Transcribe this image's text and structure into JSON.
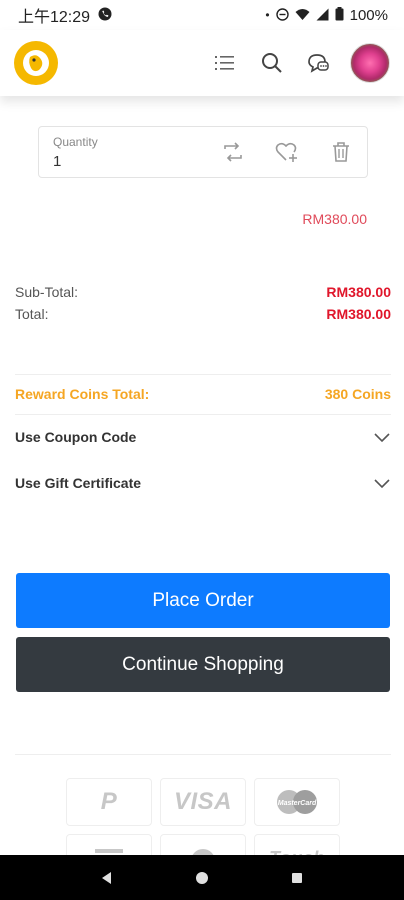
{
  "status_bar": {
    "time": "上午12:29",
    "battery": "100%"
  },
  "quantity": {
    "label": "Quantity",
    "value": "1"
  },
  "item_price": "RM380.00",
  "totals": {
    "subtotal_label": "Sub-Total:",
    "subtotal_value": "RM380.00",
    "total_label": "Total:",
    "total_value": "RM380.00"
  },
  "reward": {
    "label": "Reward Coins Total:",
    "value": "380 Coins"
  },
  "accordions": {
    "coupon_label": "Use Coupon Code",
    "gift_label": "Use Gift Certificate"
  },
  "buttons": {
    "place_order": "Place Order",
    "continue_shopping": "Continue Shopping"
  },
  "payments": {
    "paypal": "P",
    "visa": "VISA",
    "mastercard": "MasterCard",
    "touch": "Touch"
  },
  "colors": {
    "primary": "#0d7bff",
    "dark": "#343a40",
    "price_red": "#e0162b",
    "reward_orange": "#f5a623",
    "logo_yellow": "#f5b800"
  }
}
